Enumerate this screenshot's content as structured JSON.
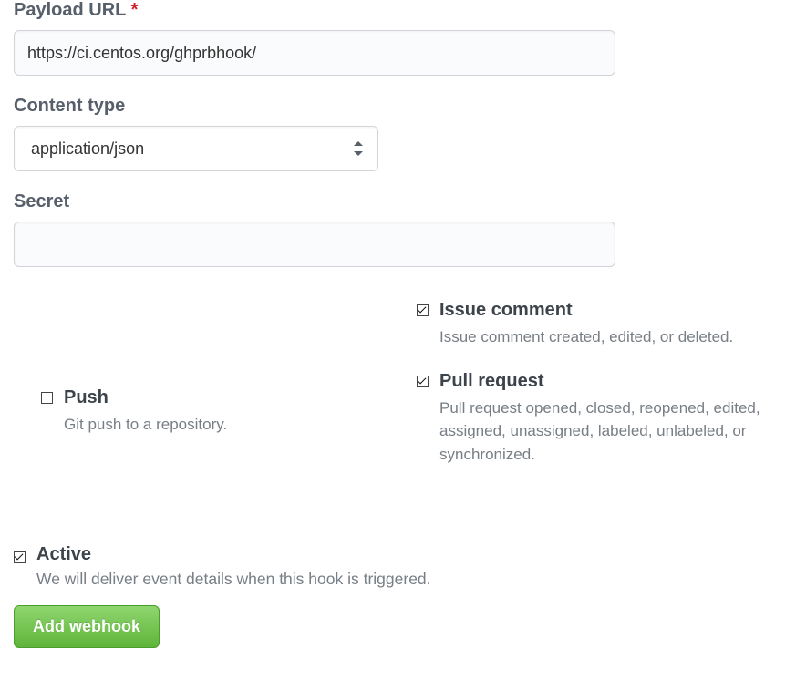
{
  "form": {
    "payload_url": {
      "label": "Payload URL",
      "required_mark": "*",
      "value": "https://ci.centos.org/ghprbhook/"
    },
    "content_type": {
      "label": "Content type",
      "value": "application/json"
    },
    "secret": {
      "label": "Secret",
      "value": ""
    }
  },
  "events": {
    "push": {
      "title": "Push",
      "desc": "Git push to a repository.",
      "checked": false
    },
    "issue_comment": {
      "title": "Issue comment",
      "desc": "Issue comment created, edited, or deleted.",
      "checked": true
    },
    "pull_request": {
      "title": "Pull request",
      "desc": "Pull request opened, closed, reopened, edited, assigned, unassigned, labeled, unlabeled, or synchronized.",
      "checked": true
    }
  },
  "active": {
    "title": "Active",
    "desc": "We will deliver event details when this hook is triggered.",
    "checked": true
  },
  "submit": {
    "label": "Add webhook"
  }
}
